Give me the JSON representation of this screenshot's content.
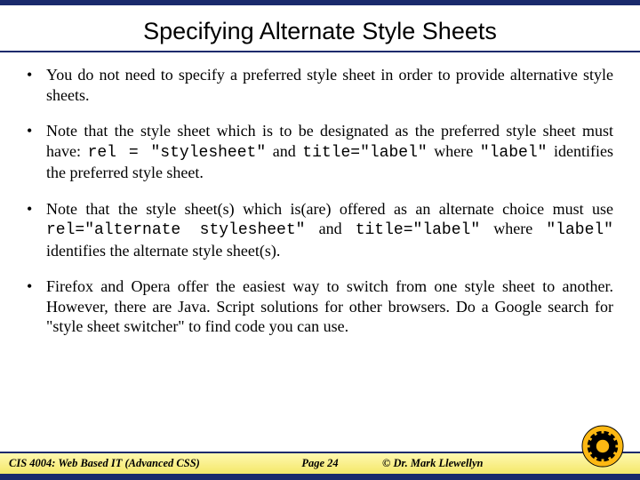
{
  "title": "Specifying Alternate Style Sheets",
  "bullets": [
    {
      "html": "You do not need to specify a preferred style sheet in order to provide alternative style sheets."
    },
    {
      "html": "Note that the style sheet which is to be designated as the preferred style sheet must have: <span class='code'>rel = \"stylesheet\"</span> and <span class='code'>title=\"label\"</span> where <span class='code'>\"label\"</span> identifies the preferred style sheet."
    },
    {
      "html": "Note that the style sheet(s) which is(are) offered as an alternate choice must use <span class='code'>rel=\"alternate stylesheet\"</span> and <span class='code'>title=\"label\"</span> where <span class='code'>\"label\"</span> identifies the alternate style sheet(s)."
    },
    {
      "html": "Firefox and Opera offer the easiest way to switch from one style sheet to another. However, there are Java. Script solutions for other browsers. Do a Google search for \"style sheet switcher\" to find code you can use."
    }
  ],
  "footer": {
    "course": "CIS 4004: Web Based IT (Advanced CSS)",
    "page": "Page 24",
    "author": "© Dr. Mark Llewellyn"
  }
}
